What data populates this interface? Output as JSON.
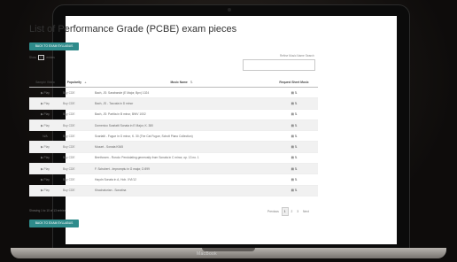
{
  "device": {
    "brand": "MacBook"
  },
  "page": {
    "title": "List of Performance Grade (PCBE) exam pieces"
  },
  "buttons": {
    "back_top": "BACK TO EXAM SYLLABUS",
    "back_bottom": "BACK TO EXAM SYLLABUS"
  },
  "controls": {
    "show_label": "Show",
    "entries_value": "10",
    "entries_label": "entries",
    "search_label": "Refine Music Name Search"
  },
  "table": {
    "headers": [
      "Sample Video",
      "Popularity",
      "Music Name",
      "Request Sheet Music"
    ],
    "rows": [
      {
        "play": "▶ Play",
        "popularity": "Buy CDE",
        "name": "Bach, JS: Sarabande (E Major, Bpv) 1024",
        "req": "▤ ⇅"
      },
      {
        "play": "▶ Play",
        "popularity": "Buy CDE",
        "name": "Bach, JS - Toccata in D minor",
        "req": "▤ ⇅"
      },
      {
        "play": "▶ Play",
        "popularity": "Buy CDE",
        "name": "Bach, JS: Partita in B minor, BWV 1002",
        "req": "▤ ⇅"
      },
      {
        "play": "▶ Play",
        "popularity": "Buy CDE",
        "name": "Domenico Scarlatti Sonata in E Major, K. 380",
        "req": "▤ ⇅"
      },
      {
        "play": "N/A",
        "popularity": "Buy CDE",
        "name": "Scarlatti - Fugue in G minor, K. 30 (The Cat Fugue, Schott Piano Collection)",
        "req": "▤ ⇅"
      },
      {
        "play": "▶ Play",
        "popularity": "Buy CDE",
        "name": "Mozart - Sonata K545",
        "req": "▤ ⇅"
      },
      {
        "play": "▶ Play",
        "popularity": "Buy CDE",
        "name": "Beethoven - Rondo: Pendulating generosity from Sonata in C minor, op. 13 no. 1",
        "req": "▤ ⇅"
      },
      {
        "play": "▶ Play",
        "popularity": "Buy CDE",
        "name": "F. Schubert - Impromptu in G major, D 899",
        "req": "▤ ⇅"
      },
      {
        "play": "▶ Play",
        "popularity": "Buy CDE",
        "name": "Haydn Sonata in A, Hob. XVI/12",
        "req": "▤ ⇅"
      },
      {
        "play": "▶ Play",
        "popularity": "Buy CDE",
        "name": "Khachaturian - Sonatina",
        "req": "▤ ⇅"
      }
    ]
  },
  "footer": {
    "showing": "Showing 1 to 10 of 13 entries",
    "pager": [
      "Previous",
      "1",
      "2",
      "3",
      "Next"
    ]
  }
}
